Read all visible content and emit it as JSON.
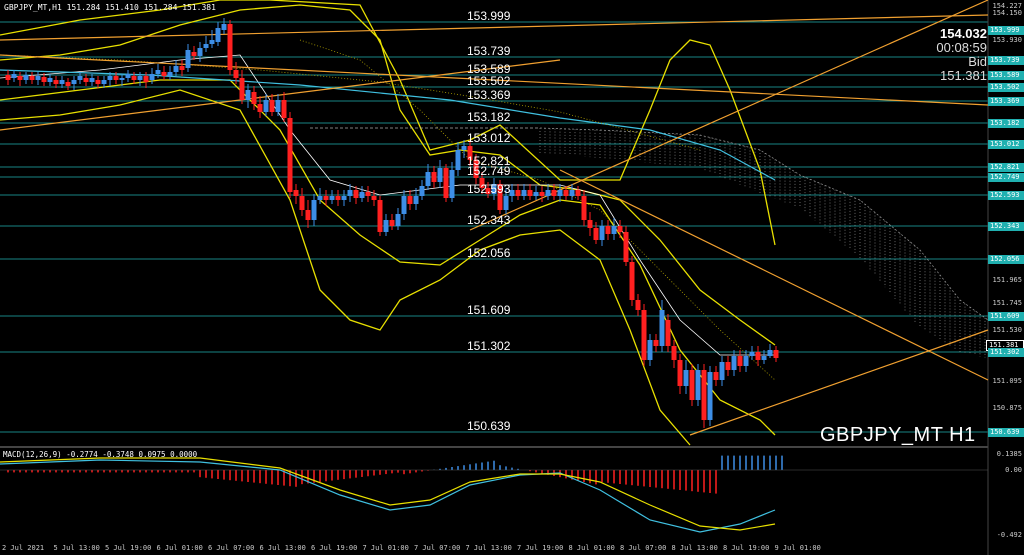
{
  "title_bar": "GBPJPY_MT,H1  151.284 151.410 151.284 151.381",
  "symbol_watermark": "GBPJPY_MT H1",
  "info_panel": {
    "line1": "154.032",
    "line2": "00:08:59",
    "line3": "Bid",
    "line4": "151.381"
  },
  "macd": {
    "label": "MACD(12,26,9) -0.2774 -0.3748 0.0975 0.0000",
    "axis": [
      "0.1385",
      "0.00",
      "-0.492"
    ]
  },
  "levels": [
    "153.999",
    "153.739",
    "153.589",
    "153.502",
    "153.369",
    "153.182",
    "153.012",
    "152.821",
    "152.749",
    "152.593",
    "152.343",
    "152.056",
    "151.609",
    "151.302",
    "150.639"
  ],
  "price_axis": [
    "154.227",
    "154.150",
    "153.930",
    "153.055",
    "152.475",
    "152.140",
    "151.965",
    "151.745",
    "151.530",
    "151.095",
    "150.875"
  ],
  "price_tags": [
    "153.999",
    "153.739",
    "153.589",
    "153.502",
    "153.369",
    "153.182",
    "153.012",
    "152.821",
    "152.749",
    "152.593",
    "152.343",
    "152.056",
    "151.609",
    "151.381",
    "151.302",
    "150.639"
  ],
  "time_axis": [
    "2 Jul 2021",
    "5 Jul 13:00",
    "5 Jul 19:00",
    "6 Jul 01:00",
    "6 Jul 07:00",
    "6 Jul 13:00",
    "6 Jul 19:00",
    "7 Jul 01:00",
    "7 Jul 07:00",
    "7 Jul 13:00",
    "7 Jul 19:00",
    "8 Jul 01:00",
    "8 Jul 07:00",
    "8 Jul 13:00",
    "8 Jul 19:00",
    "9 Jul 01:00"
  ],
  "colors": {
    "bull": "#3d8ee6",
    "bear": "#ff2020",
    "band": "#e8e000",
    "trend": "#f0a030",
    "level": "#20b0b0",
    "kijun": "#40c0e0"
  }
}
